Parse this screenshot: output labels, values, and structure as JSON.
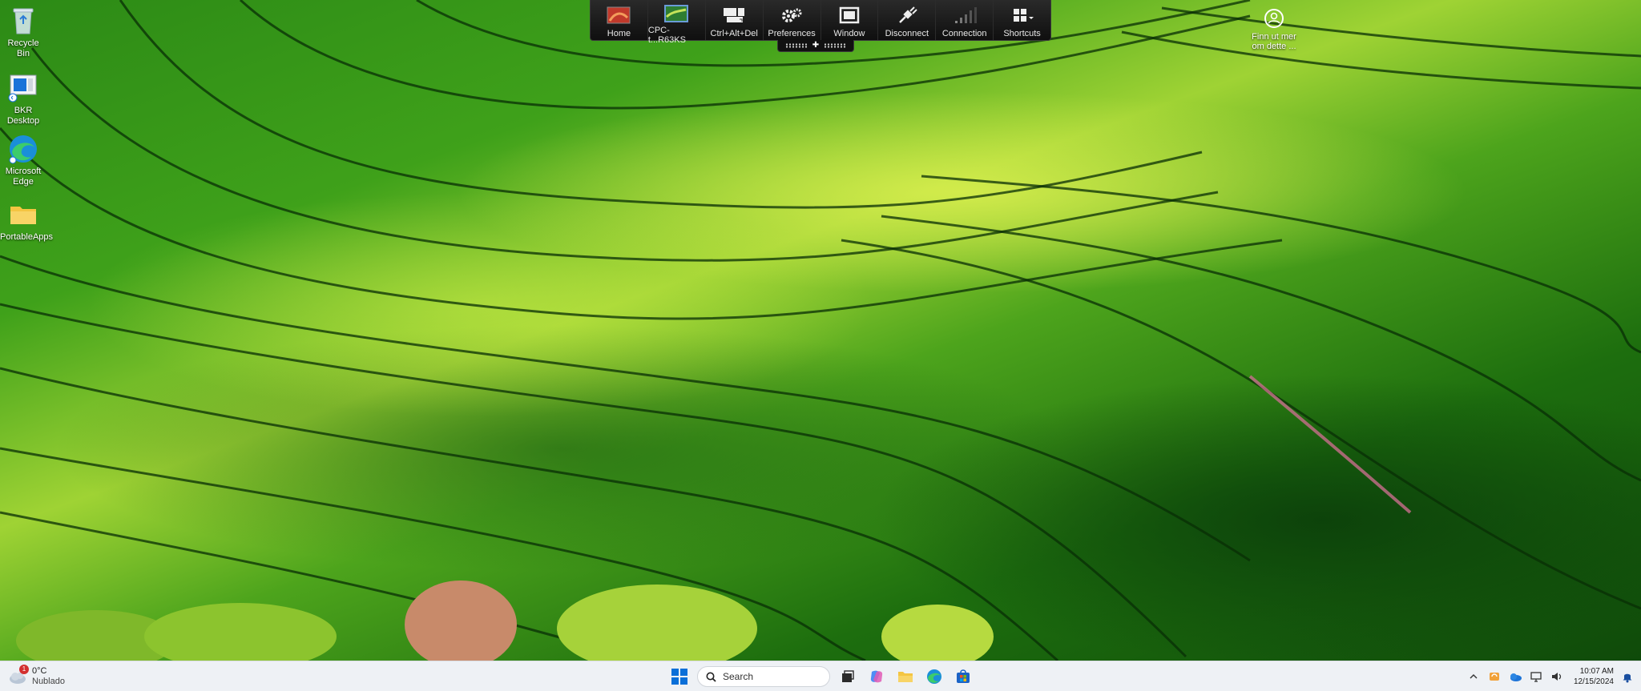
{
  "desktop": {
    "icons": [
      {
        "label": "Recycle Bin"
      },
      {
        "label": "BKR Desktop"
      },
      {
        "label": "Microsoft Edge"
      },
      {
        "label": "PortableApps"
      }
    ],
    "help_label": "Finn ut mer om dette ..."
  },
  "remote_toolbar": {
    "buttons": [
      {
        "label": "Home",
        "icon": "home-icon"
      },
      {
        "label": "CPC-t...R63KS",
        "icon": "monitor-thumbnail-icon"
      },
      {
        "label": "Ctrl+Alt+Del",
        "icon": "keyboard-icon"
      },
      {
        "label": "Preferences",
        "icon": "gear-icon"
      },
      {
        "label": "Window",
        "icon": "window-icon"
      },
      {
        "label": "Disconnect",
        "icon": "disconnect-icon"
      },
      {
        "label": "Connection",
        "icon": "signal-bars-icon"
      },
      {
        "label": "Shortcuts",
        "icon": "grid-icon"
      }
    ]
  },
  "taskbar": {
    "weather": {
      "temperature": "0°C",
      "condition": "Nublado",
      "badge": "1"
    },
    "search_placeholder": "Search",
    "clock": {
      "time": "10:07 AM",
      "date": "12/15/2024"
    }
  },
  "colors": {
    "taskbar_bg": "#eef1f5",
    "toolbar_bg": "#141414",
    "win_blue": "#0a6fd8"
  }
}
